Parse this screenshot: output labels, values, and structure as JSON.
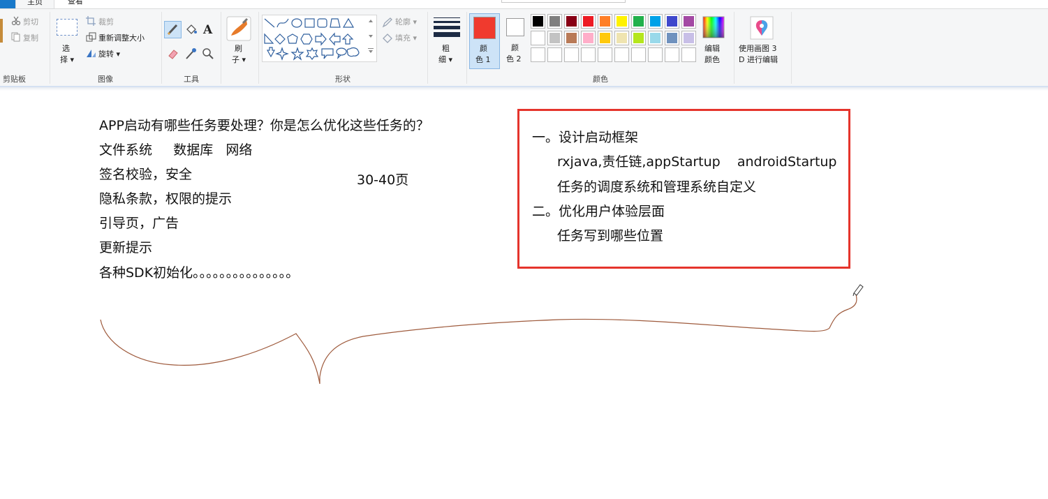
{
  "tabs": {
    "file": "",
    "home": "主页",
    "view": "查看"
  },
  "clipboard": {
    "cut": "剪切",
    "copy": "复制",
    "group_label": "剪贴板"
  },
  "image": {
    "select_line1": "选",
    "select_line2": "择",
    "crop": "裁剪",
    "resize": "重新调整大小",
    "rotate": "旋转",
    "group_label": "图像"
  },
  "tools": {
    "group_label": "工具"
  },
  "brushes": {
    "line1": "刷",
    "line2": "子"
  },
  "shapes": {
    "outline": "轮廓",
    "fill": "填充",
    "group_label": "形状"
  },
  "size": {
    "line1": "粗",
    "line2": "细"
  },
  "color1": {
    "line1": "颜",
    "line2": "色 1",
    "value": "#f03a2e"
  },
  "color2": {
    "line1": "颜",
    "line2": "色 2",
    "value": "#ffffff"
  },
  "colors": {
    "group_label": "颜色",
    "edit_line1": "编辑",
    "edit_line2": "颜色",
    "row1": [
      "#000000",
      "#7f7f7f",
      "#880015",
      "#ed1c24",
      "#ff7f27",
      "#fff200",
      "#22b14c",
      "#00a2e8",
      "#3f48cc",
      "#a349a4"
    ],
    "row2": [
      "#ffffff",
      "#c3c3c3",
      "#b97a57",
      "#ffaec9",
      "#ffc90e",
      "#efe4b0",
      "#b5e61d",
      "#99d9ea",
      "#7092be",
      "#c8bfe7"
    ]
  },
  "paint3d": {
    "line1": "使用画图 3",
    "line2": "D 进行编辑"
  },
  "canvas": {
    "lines": [
      "APP启动有哪些任务要处理？你是怎么优化这些任务的？",
      "文件系统     数据库   网络",
      "签名校验，安全",
      "隐私条款，权限的提示",
      "引导页，广告",
      "更新提示",
      "各种SDK初始化。。。。。。。。。。。。。。。"
    ],
    "pages": "30-40页",
    "box_lines": [
      "一。设计启动框架",
      "rxjava,责任链,appStartup    androidStartup",
      "任务的调度系统和管理系统自定义",
      "二。优化用户体验层面",
      "任务写到哪些位置"
    ]
  }
}
